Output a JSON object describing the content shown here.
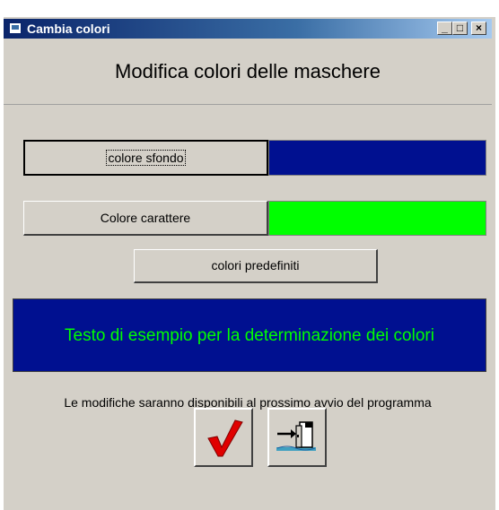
{
  "window": {
    "title": "Cambia colori",
    "minimize_glyph": "_",
    "maximize_glyph": "□",
    "close_glyph": "×"
  },
  "header": {
    "title": "Modifica colori delle maschere"
  },
  "buttons": {
    "background_color": "colore sfondo",
    "text_color": "Colore carattere",
    "presets": "colori predefiniti"
  },
  "colors": {
    "background": "#001090",
    "text": "#00ff00"
  },
  "sample": {
    "text": "Testo di esempio per la determinazione dei colori"
  },
  "note": "Le modifiche saranno disponibili al prossimo avvio del programma",
  "actions": {
    "confirm_icon": "checkmark-icon",
    "exit_icon": "exit-door-icon"
  }
}
